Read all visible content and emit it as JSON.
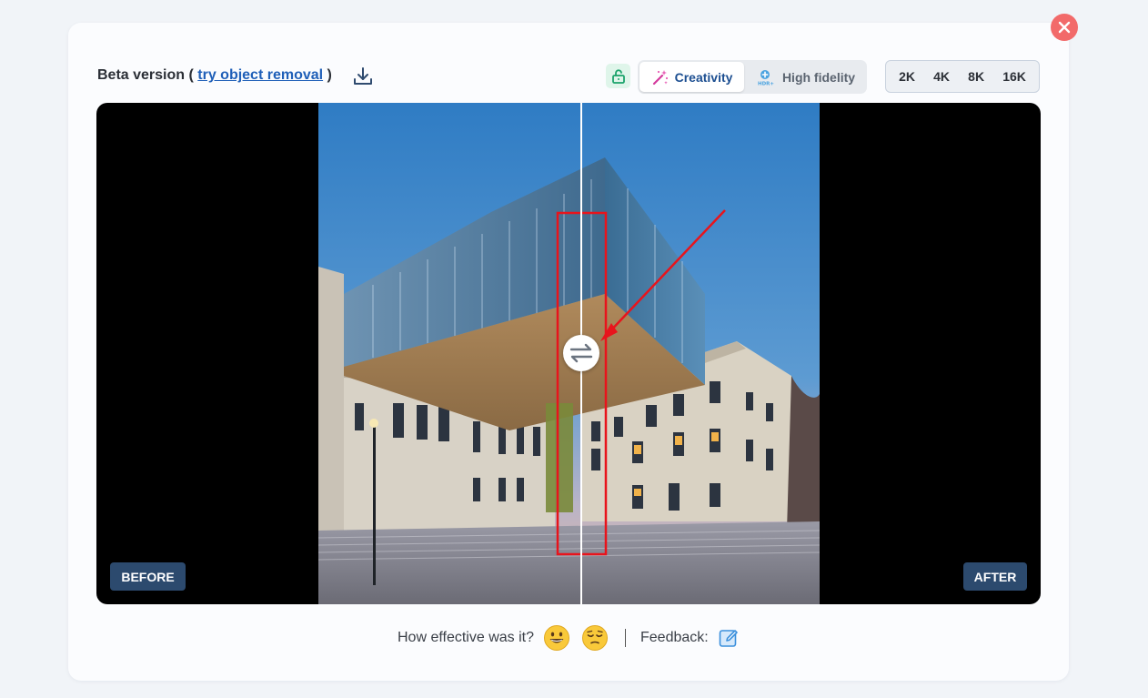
{
  "header": {
    "beta_prefix": "Beta version (",
    "beta_link": "try object removal",
    "beta_suffix": ")",
    "download_icon": "download-icon",
    "lock_icon": "unlock-icon"
  },
  "modes": {
    "creativity_label": "Creativity",
    "fidelity_label": "High fidelity",
    "active": "Creativity"
  },
  "resolutions": [
    "2K",
    "4K",
    "8K",
    "16K"
  ],
  "viewer": {
    "before_label": "BEFORE",
    "after_label": "AFTER",
    "handle_icon": "swap-arrows-icon",
    "split_position": 0.52
  },
  "footer": {
    "question": "How effective was it?",
    "feedback_label": "Feedback:",
    "positive_icon": "grinning-face-icon",
    "negative_icon": "relieved-face-icon",
    "feedback_icon": "edit-note-icon"
  },
  "colors": {
    "accent": "#1d4f91",
    "close": "#f26a6a",
    "label_bg": "#2c4a6e",
    "annotation": "#e8141c"
  }
}
